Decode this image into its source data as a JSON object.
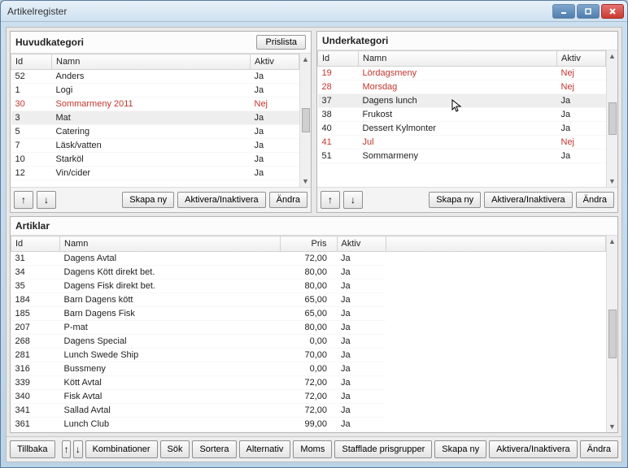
{
  "window": {
    "title": "Artikelregister"
  },
  "huvud": {
    "title": "Huvudkategori",
    "prislista_btn": "Prislista",
    "cols": {
      "id": "Id",
      "namn": "Namn",
      "aktiv": "Aktiv"
    },
    "rows": [
      {
        "id": "52",
        "namn": "Anders",
        "aktiv": "Ja",
        "inactive": false
      },
      {
        "id": "1",
        "namn": "Logi",
        "aktiv": "Ja",
        "inactive": false
      },
      {
        "id": "30",
        "namn": "Sommarmeny 2011",
        "aktiv": "Nej",
        "inactive": true
      },
      {
        "id": "3",
        "namn": "Mat",
        "aktiv": "Ja",
        "inactive": false,
        "sel": true
      },
      {
        "id": "5",
        "namn": "Catering",
        "aktiv": "Ja",
        "inactive": false
      },
      {
        "id": "7",
        "namn": "Läsk/vatten",
        "aktiv": "Ja",
        "inactive": false
      },
      {
        "id": "10",
        "namn": "Starköl",
        "aktiv": "Ja",
        "inactive": false
      },
      {
        "id": "12",
        "namn": "Vin/cider",
        "aktiv": "Ja",
        "inactive": false
      }
    ],
    "btns": {
      "up": "↑",
      "down": "↓",
      "skapa_ny": "Skapa ny",
      "aktivera": "Aktivera/Inaktivera",
      "andra": "Ändra"
    }
  },
  "under": {
    "title": "Underkategori",
    "cols": {
      "id": "Id",
      "namn": "Namn",
      "aktiv": "Aktiv"
    },
    "rows": [
      {
        "id": "19",
        "namn": "Lördagsmeny",
        "aktiv": "Nej",
        "inactive": true
      },
      {
        "id": "28",
        "namn": "Morsdag",
        "aktiv": "Nej",
        "inactive": true
      },
      {
        "id": "37",
        "namn": "Dagens lunch",
        "aktiv": "Ja",
        "inactive": false,
        "sel": true
      },
      {
        "id": "38",
        "namn": "Frukost",
        "aktiv": "Ja",
        "inactive": false
      },
      {
        "id": "40",
        "namn": "Dessert Kylmonter",
        "aktiv": "Ja",
        "inactive": false
      },
      {
        "id": "41",
        "namn": "Jul",
        "aktiv": "Nej",
        "inactive": true
      },
      {
        "id": "51",
        "namn": "Sommarmeny",
        "aktiv": "Ja",
        "inactive": false
      }
    ],
    "btns": {
      "up": "↑",
      "down": "↓",
      "skapa_ny": "Skapa ny",
      "aktivera": "Aktivera/Inaktivera",
      "andra": "Ändra"
    }
  },
  "artiklar": {
    "title": "Artiklar",
    "cols": {
      "id": "Id",
      "namn": "Namn",
      "pris": "Pris",
      "aktiv": "Aktiv"
    },
    "rows": [
      {
        "id": "31",
        "namn": "Dagens Avtal",
        "pris": "72,00",
        "aktiv": "Ja"
      },
      {
        "id": "34",
        "namn": "Dagens Kött direkt bet.",
        "pris": "80,00",
        "aktiv": "Ja"
      },
      {
        "id": "35",
        "namn": "Dagens Fisk direkt bet.",
        "pris": "80,00",
        "aktiv": "Ja"
      },
      {
        "id": "184",
        "namn": "Barn Dagens kött",
        "pris": "65,00",
        "aktiv": "Ja"
      },
      {
        "id": "185",
        "namn": "Barn Dagens Fisk",
        "pris": "65,00",
        "aktiv": "Ja"
      },
      {
        "id": "207",
        "namn": "P-mat",
        "pris": "80,00",
        "aktiv": "Ja"
      },
      {
        "id": "268",
        "namn": "Dagens Special",
        "pris": "0,00",
        "aktiv": "Ja"
      },
      {
        "id": "281",
        "namn": "Lunch Swede Ship",
        "pris": "70,00",
        "aktiv": "Ja"
      },
      {
        "id": "316",
        "namn": "Bussmeny",
        "pris": "0,00",
        "aktiv": "Ja"
      },
      {
        "id": "339",
        "namn": "Kött Avtal",
        "pris": "72,00",
        "aktiv": "Ja"
      },
      {
        "id": "340",
        "namn": "Fisk Avtal",
        "pris": "72,00",
        "aktiv": "Ja"
      },
      {
        "id": "341",
        "namn": "Sallad Avtal",
        "pris": "72,00",
        "aktiv": "Ja"
      },
      {
        "id": "361",
        "namn": "Lunch Club",
        "pris": "99,00",
        "aktiv": "Ja"
      }
    ]
  },
  "bottombar": {
    "tillbaka": "Tillbaka",
    "kombinationer": "Kombinationer",
    "sok": "Sök",
    "sortera": "Sortera",
    "alternativ": "Alternativ",
    "moms": "Moms",
    "stafflade": "Stafflade prisgrupper",
    "skapa_ny": "Skapa ny",
    "aktivera": "Aktivera/Inaktivera",
    "andra": "Ändra"
  }
}
